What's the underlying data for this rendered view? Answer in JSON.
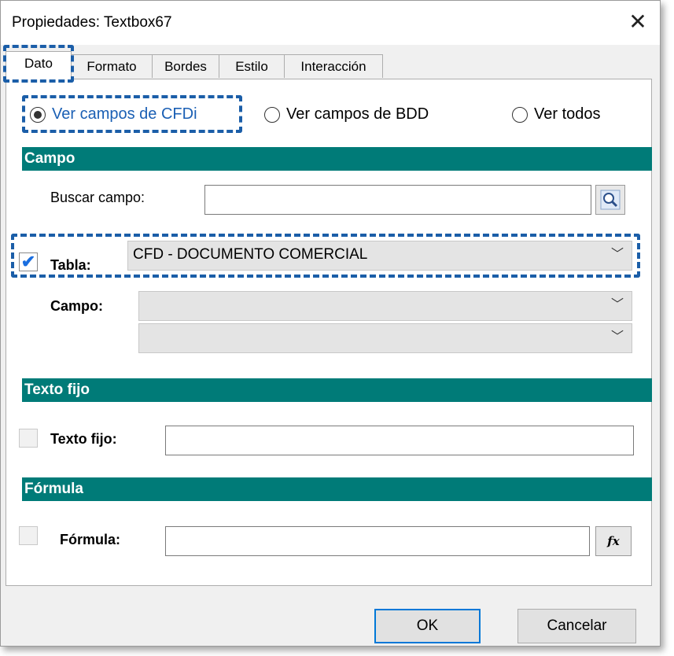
{
  "window": {
    "title": "Propiedades: Textbox67",
    "close_glyph": "✕"
  },
  "tabs": [
    {
      "label": "Dato",
      "active": true
    },
    {
      "label": "Formato"
    },
    {
      "label": "Bordes"
    },
    {
      "label": "Estilo"
    },
    {
      "label": "Interacción"
    }
  ],
  "view_options": [
    {
      "label": "Ver campos de CFDi",
      "selected": true
    },
    {
      "label": "Ver campos de BDD",
      "selected": false
    },
    {
      "label": "Ver todos",
      "selected": false
    }
  ],
  "campo_section": {
    "header": "Campo",
    "search_label": "Buscar campo:",
    "search_value": "",
    "search_icon": "magnifier-icon",
    "tabla_checked": true,
    "check_glyph": "✔",
    "tabla_label": "Tabla:",
    "tabla_value": "CFD - DOCUMENTO COMERCIAL",
    "campo_label": "Campo:",
    "campo_value": "",
    "campo2_value": ""
  },
  "texto_fijo_section": {
    "header": "Texto fijo",
    "label": "Texto fijo:",
    "checked": false,
    "value": ""
  },
  "formula_section": {
    "header": "Fórmula",
    "label": "Fórmula:",
    "checked": false,
    "value": "",
    "fx_label": "fx"
  },
  "buttons": {
    "ok": "OK",
    "cancel": "Cancelar"
  },
  "icons": {
    "chevron": "﹀"
  },
  "colors": {
    "section_header": "#007b78",
    "highlight_dash": "#1b5ea8",
    "selected_text": "#1a5fb4"
  }
}
